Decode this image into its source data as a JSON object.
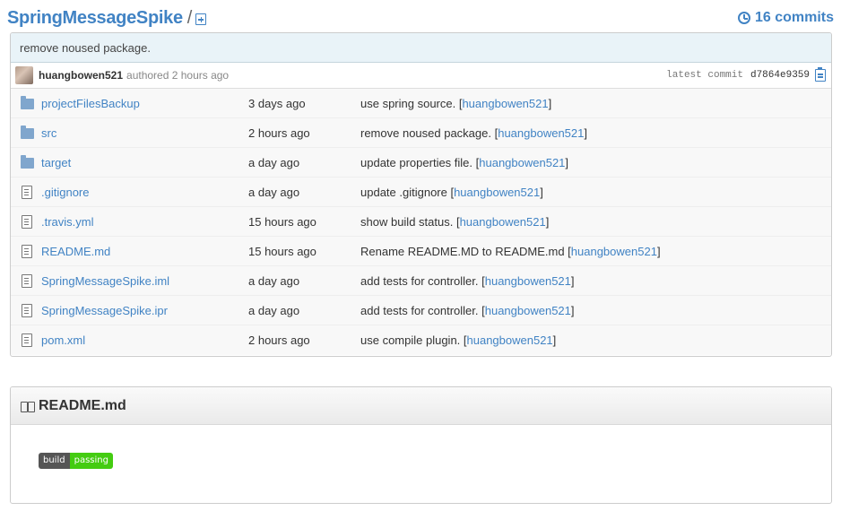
{
  "header": {
    "repo_name": "SpringMessageSpike",
    "separator": "/",
    "commits_label": "16 commits"
  },
  "latest_commit": {
    "message": "remove noused package.",
    "author": "huangbowen521",
    "authored_text": "authored 2 hours ago",
    "label": "latest commit",
    "sha": "d7864e9359"
  },
  "files": [
    {
      "icon": "folder-icon",
      "name": "projectFilesBackup",
      "age": "3 days ago",
      "message": "use spring source. [",
      "author": "huangbowen521",
      "close": "]"
    },
    {
      "icon": "folder-icon",
      "name": "src",
      "age": "2 hours ago",
      "message": "remove noused package. [",
      "author": "huangbowen521",
      "close": "]"
    },
    {
      "icon": "folder-icon",
      "name": "target",
      "age": "a day ago",
      "message": "update properties file. [",
      "author": "huangbowen521",
      "close": "]"
    },
    {
      "icon": "file-icon",
      "name": ".gitignore",
      "age": "a day ago",
      "message": "update .gitignore [",
      "author": "huangbowen521",
      "close": "]"
    },
    {
      "icon": "file-icon",
      "name": ".travis.yml",
      "age": "15 hours ago",
      "message": "show build status. [",
      "author": "huangbowen521",
      "close": "]"
    },
    {
      "icon": "file-icon",
      "name": "README.md",
      "age": "15 hours ago",
      "message": "Rename README.MD to README.md [",
      "author": "huangbowen521",
      "close": "]"
    },
    {
      "icon": "file-icon",
      "name": "SpringMessageSpike.iml",
      "age": "a day ago",
      "message": "add tests for controller. [",
      "author": "huangbowen521",
      "close": "]"
    },
    {
      "icon": "file-icon",
      "name": "SpringMessageSpike.ipr",
      "age": "a day ago",
      "message": "add tests for controller. [",
      "author": "huangbowen521",
      "close": "]"
    },
    {
      "icon": "file-icon",
      "name": "pom.xml",
      "age": "2 hours ago",
      "message": "use compile plugin. [",
      "author": "huangbowen521",
      "close": "]"
    }
  ],
  "readme": {
    "title": "README.md",
    "badge_left": "build",
    "badge_right": "passing"
  },
  "colors": {
    "link": "#4183c4",
    "badge_pass": "#44cc11"
  }
}
